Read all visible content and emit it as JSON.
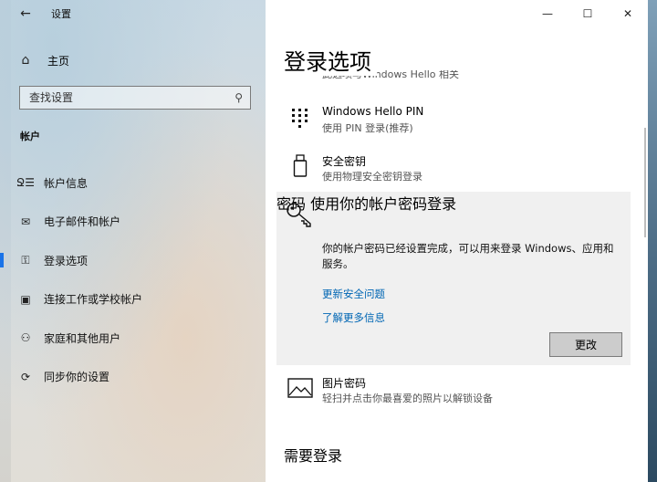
{
  "window": {
    "title": "设置",
    "minimize_glyph": "—",
    "maximize_glyph": "☐",
    "close_glyph": "✕"
  },
  "nav": {
    "back_glyph": "←",
    "home": {
      "label": "主页",
      "icon": "home-icon",
      "glyph": "⌂"
    },
    "search": {
      "placeholder": "查找设置",
      "icon": "search-icon",
      "glyph": "⚲"
    },
    "section": "帐户",
    "items": [
      {
        "label": "帐户信息",
        "icon": "person-list-icon",
        "glyph": "Ջ☰",
        "active": false
      },
      {
        "label": "电子邮件和帐户",
        "icon": "mail-icon",
        "glyph": "✉",
        "active": false
      },
      {
        "label": "登录选项",
        "icon": "key-icon",
        "glyph": "⚿",
        "active": true
      },
      {
        "label": "连接工作或学校帐户",
        "icon": "briefcase-icon",
        "glyph": "▣",
        "active": false
      },
      {
        "label": "家庭和其他用户",
        "icon": "add-person-icon",
        "glyph": "⚇",
        "active": false
      },
      {
        "label": "同步你的设置",
        "icon": "sync-icon",
        "glyph": "⟳",
        "active": false
      }
    ]
  },
  "content": {
    "page_title": "登录选项",
    "cut_text": "此选项与Windows Hello 相关",
    "hello_pin": {
      "title": "Windows Hello PIN",
      "sub": "使用 PIN 登录(推荐)"
    },
    "security_key": {
      "title": "安全密钥",
      "sub": "使用物理安全密钥登录"
    },
    "password": {
      "title": "密码",
      "sub": "使用你的帐户密码登录",
      "desc": "你的帐户密码已经设置完成，可以用来登录 Windows、应用和服务。",
      "link1": "更新安全问题",
      "link2": "了解更多信息",
      "button": "更改"
    },
    "picture_password": {
      "title": "图片密码",
      "sub": "轻扫并点击你最喜爱的照片以解锁设备"
    },
    "need_login": "需要登录"
  },
  "colors": {
    "accent": "#1a73e8",
    "link": "#0066b4",
    "selected_bg": "#f0f0f0"
  }
}
